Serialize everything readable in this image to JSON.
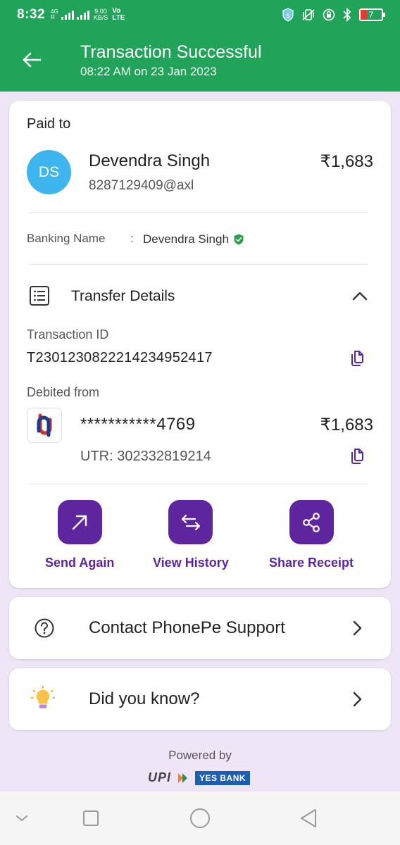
{
  "status_bar": {
    "time": "8:32",
    "network_type": "4G",
    "roaming": "R",
    "speed_value": "9.00",
    "speed_unit": "KB/S",
    "volte": "Vo",
    "lte": "LTE",
    "battery": "7"
  },
  "header": {
    "title": "Transaction Successful",
    "subtitle": "08:22 AM on 23 Jan 2023",
    "background_color": "#21a35a"
  },
  "payment": {
    "paid_to_label": "Paid to",
    "avatar_initials": "DS",
    "payee_name": "Devendra Singh",
    "payee_upi": "8287129409@axl",
    "amount": "₹1,683",
    "banking_name_label": "Banking Name",
    "banking_name_separator": ":",
    "banking_name_value": "Devendra Singh"
  },
  "transfer_details": {
    "title": "Transfer Details",
    "transaction_id_label": "Transaction ID",
    "transaction_id": "T2301230822214234952417",
    "debited_from_label": "Debited from",
    "account_masked": "***********4769",
    "debited_amount": "₹1,683",
    "utr": "UTR: 302332819214"
  },
  "actions": [
    {
      "label": "Send Again",
      "icon": "arrow-up-right-icon"
    },
    {
      "label": "View History",
      "icon": "swap-arrows-icon"
    },
    {
      "label": "Share Receipt",
      "icon": "share-icon"
    }
  ],
  "support": {
    "contact_label": "Contact PhonePe Support",
    "did_you_know_label": "Did you know?"
  },
  "footer": {
    "powered_by": "Powered by",
    "upi_logo_text": "UPI",
    "bank_logo_text": "YES BANK"
  },
  "colors": {
    "primary_purple": "#5f259f",
    "success_green": "#21a35a",
    "avatar_blue": "#3fb5f0",
    "page_background": "#eee6f6"
  }
}
